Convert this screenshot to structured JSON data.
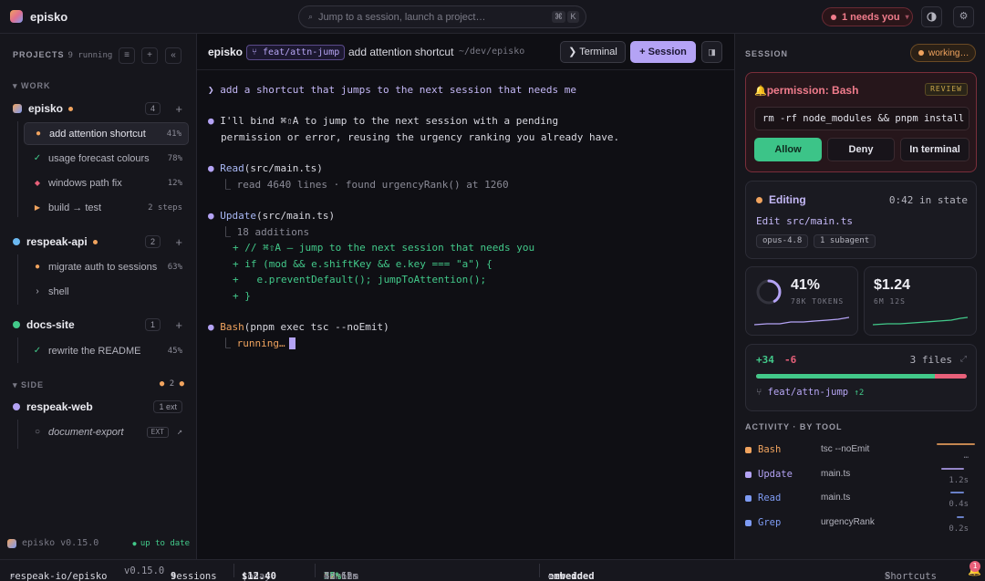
{
  "app": {
    "title": "episko"
  },
  "search": {
    "placeholder": "Jump to a session, launch a project…",
    "key1": "⌘",
    "key2": "K"
  },
  "topbar": {
    "needs_you": "1 needs you",
    "theme_icon": "contrast-icon",
    "settings_icon": "gear-icon"
  },
  "sidebar": {
    "header": "PROJECTS",
    "running": "9 running",
    "groups": [
      {
        "label": "WORK"
      },
      {
        "label": "SIDE",
        "count": "2"
      }
    ],
    "projects": [
      {
        "name": "episko",
        "badge": "4",
        "color": "#7e9bf3",
        "sessions": [
          {
            "label": "add attention shortcut",
            "meta": "41%",
            "icon": "●",
            "color": "#f0a35e"
          },
          {
            "label": "usage forecast colours",
            "meta": "78%",
            "icon": "✓",
            "color": "#42c98a"
          },
          {
            "label": "windows path fix",
            "meta": "12%",
            "icon": "◆",
            "color": "#e8607a"
          },
          {
            "label": "build → test",
            "meta": "2 steps",
            "icon": "▶",
            "color": "#f0a35e"
          }
        ]
      },
      {
        "name": "respeak-api",
        "badge": "2",
        "color": "#6bb8f0",
        "sessions": [
          {
            "label": "migrate auth to sessions",
            "meta": "63%",
            "icon": "●",
            "color": "#f0a35e"
          },
          {
            "label": "shell",
            "meta": "",
            "icon": "›",
            "color": "#b4b4be"
          }
        ]
      },
      {
        "name": "docs-site",
        "badge": "1",
        "color": "#42c98a",
        "sessions": [
          {
            "label": "rewrite the README",
            "meta": "45%",
            "icon": "✓",
            "color": "#42c98a"
          }
        ]
      },
      {
        "name": "respeak-web",
        "badge": "1 ext",
        "color": "#b4a3f5",
        "sessions": [
          {
            "label": "document-export",
            "meta": "EXT",
            "icon": "○",
            "color": "#8a8a96"
          }
        ]
      }
    ],
    "footer": {
      "version": "episko v0.15.0",
      "status": "up to date"
    }
  },
  "main": {
    "title": "episko",
    "branch": "feat/attn-jump",
    "task": "add attention shortcut",
    "path": "~/dev/episko",
    "terminal_label": "Terminal",
    "session_label": "Session",
    "transcript": {
      "prompt": "add a shortcut that jumps to the next session that needs me",
      "msg1": "I'll bind ⌘⇧A to jump to the next session with a pending",
      "msg2": "permission or error, reusing the urgency ranking you already have.",
      "read_tool": "Read",
      "read_arg": "(src/main.ts)",
      "read_result": "read 4640 lines · found urgencyRank() at 1260",
      "update_tool": "Update",
      "update_arg": "(src/main.ts)",
      "update_count": "18 additions",
      "diff": [
        "+ // ⌘⇧A — jump to the next session that needs you",
        "+ if (mod && e.shiftKey && e.key === \"a\") {",
        "+   e.preventDefault(); jumpToAttention();",
        "+ }"
      ],
      "bash_tool": "Bash",
      "bash_arg": "(pnpm exec tsc --noEmit)",
      "bash_status": "running…"
    }
  },
  "panel": {
    "title": "SESSION",
    "working": "working…",
    "permission": {
      "title": "permission: Bash",
      "tag": "REVIEW",
      "command": "rm -rf node_modules && pnpm install",
      "allow": "Allow",
      "deny": "Deny",
      "in_terminal": "In terminal"
    },
    "state": {
      "name": "Editing",
      "time": "0:42 in state",
      "file": "Edit src/main.ts",
      "chips": [
        "opus-4.8",
        "1 subagent"
      ]
    },
    "tokens": {
      "percent": "41%",
      "label": "78K TOKENS",
      "fraction": 0.41
    },
    "cost": {
      "amount": "$1.24",
      "label": "6M 12S"
    },
    "diff": {
      "added": "+34",
      "removed": "-6",
      "files": "3 files",
      "branch": "feat/attn-jump",
      "ahead": "↑2",
      "added_fraction": 0.85
    },
    "activity": {
      "title": "ACTIVITY · BY TOOL",
      "rows": [
        {
          "tool": "Bash",
          "target": "tsc --noEmit",
          "time": "…",
          "color": "#f0a35e",
          "share": 1.0
        },
        {
          "tool": "Update",
          "target": "main.ts",
          "time": "1.2s",
          "color": "#b4a3f5",
          "share": 0.6
        },
        {
          "tool": "Read",
          "target": "main.ts",
          "time": "0.4s",
          "color": "#7e9bf3",
          "share": 0.35
        },
        {
          "tool": "Grep",
          "target": "urgencyRank",
          "time": "0.2s",
          "color": "#7e9bf3",
          "share": 0.2
        }
      ]
    }
  },
  "statusbar": {
    "repo": "respeak-io/episko",
    "version": "v0.15.0",
    "sessions_count": "9",
    "sessions_label": "sessions",
    "today_label": "today",
    "today_value": "$12.40",
    "limits_label": "limits",
    "limit1_pct": "62%",
    "limit1_window": "5h",
    "limit1_reset": "2h 12m",
    "limit2_pct": "38%",
    "limit2_window": "7d",
    "limit2_reset": "4d 6h",
    "new_label": "new in",
    "new_value": "embedded",
    "shortcuts": "Shortcuts",
    "notif_count": "1"
  }
}
